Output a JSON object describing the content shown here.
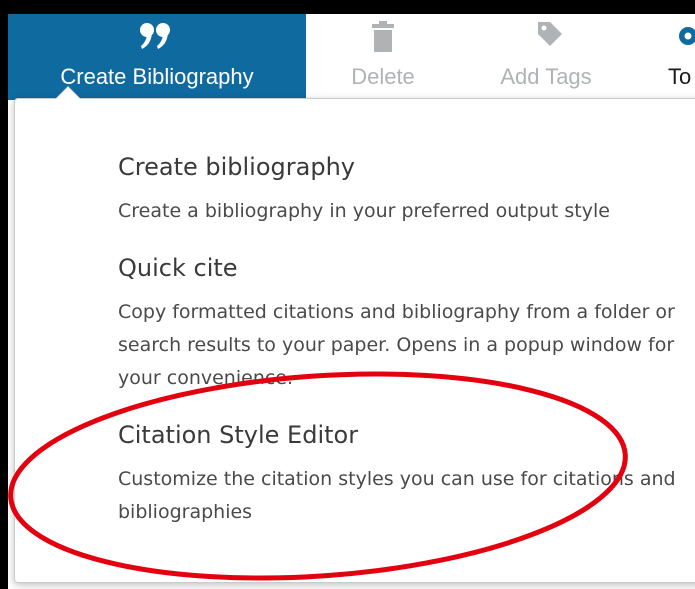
{
  "toolbar": {
    "create": {
      "label": "Create Bibliography",
      "icon": "quote-icon"
    },
    "delete": {
      "label": "Delete",
      "icon": "trash-icon"
    },
    "tags": {
      "label": "Add Tags",
      "icon": "tag-icon"
    },
    "tools": {
      "label": "To",
      "icon": "gear-icon"
    }
  },
  "menu": {
    "items": [
      {
        "title": "Create bibliography",
        "description": "Create a bibliography in your preferred output style"
      },
      {
        "title": "Quick cite",
        "description": "Copy formatted citations and bibliography from a folder or search results to your paper. Opens in a popup window for your convenience."
      },
      {
        "title": "Citation Style Editor",
        "description": "Customize the citation styles you can use for citations and bibliographies"
      }
    ]
  },
  "colors": {
    "accent": "#0f6aa0",
    "annotation": "#e3000f",
    "disabled": "#b0b3b6"
  }
}
